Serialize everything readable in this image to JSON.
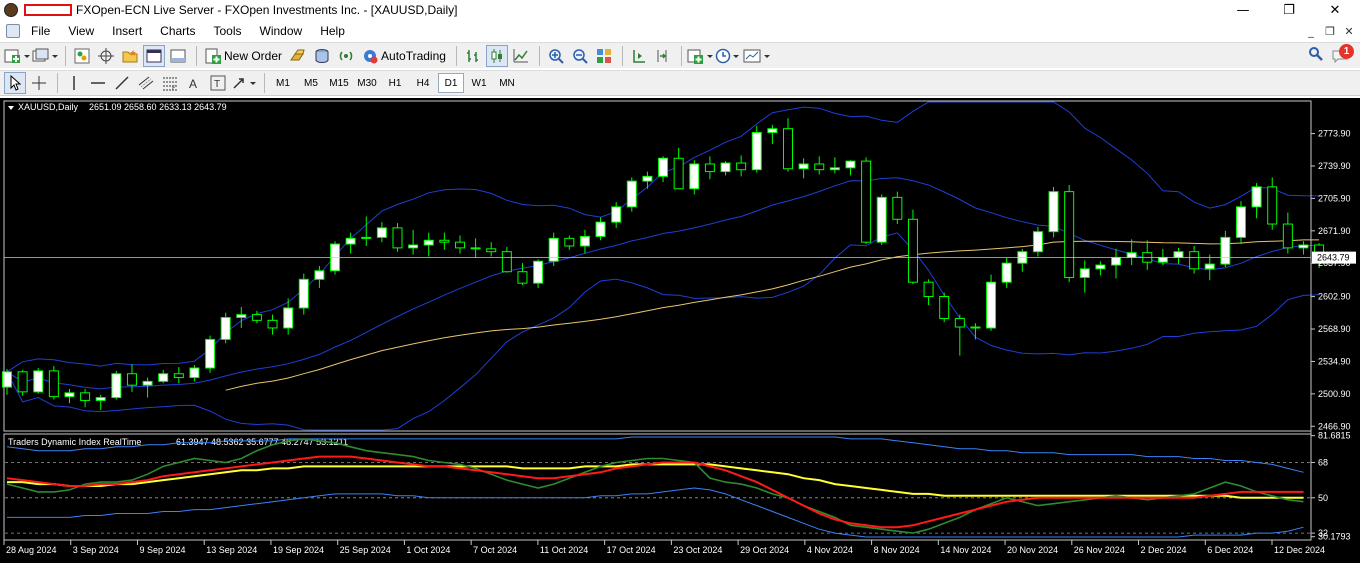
{
  "window": {
    "title": "FXOpen-ECN Live Server - FXOpen Investments Inc. - [XAUUSD,Daily]",
    "controls": [
      "—",
      "❐",
      "✕"
    ]
  },
  "menu": [
    "File",
    "View",
    "Insert",
    "Charts",
    "Tools",
    "Window",
    "Help"
  ],
  "mdi_controls": [
    "_",
    "❐",
    "✕"
  ],
  "toolbar": {
    "new_order_label": "New Order",
    "autotrading_label": "AutoTrading"
  },
  "timeframes": [
    "M1",
    "M5",
    "M15",
    "M30",
    "H1",
    "H4",
    "D1",
    "W1",
    "MN"
  ],
  "active_timeframe": "D1",
  "alerts": {
    "count": "1"
  },
  "chart_data": [
    {
      "type": "candlestick",
      "title": "XAUUSD,Daily",
      "ohlc_header": "2651.09 2658.60 2633.13 2643.79",
      "current_price": "2643.79",
      "y_ticks": [
        "2773.90",
        "2739.90",
        "2705.90",
        "2671.90",
        "2637.90",
        "2602.90",
        "2568.90",
        "2534.90",
        "2500.90",
        "2466.90"
      ],
      "y_range": [
        2463,
        2807
      ],
      "x_ticks": [
        "28 Aug 2024",
        "3 Sep 2024",
        "9 Sep 2024",
        "13 Sep 2024",
        "19 Sep 2024",
        "25 Sep 2024",
        "1 Oct 2024",
        "7 Oct 2024",
        "11 Oct 2024",
        "17 Oct 2024",
        "23 Oct 2024",
        "29 Oct 2024",
        "4 Nov 2024",
        "8 Nov 2024",
        "14 Nov 2024",
        "20 Nov 2024",
        "26 Nov 2024",
        "2 Dec 2024",
        "6 Dec 2024",
        "12 Dec 2024"
      ],
      "background": "#000000",
      "bull_color": "#ffffff",
      "bear_color": "#000000",
      "wick_color": "#00ff00",
      "candles_ohlc": [
        [
          2508,
          2527,
          2500,
          2524
        ],
        [
          2524,
          2526,
          2499,
          2503
        ],
        [
          2503,
          2528,
          2501,
          2525
        ],
        [
          2525,
          2530,
          2495,
          2498
        ],
        [
          2498,
          2506,
          2491,
          2502
        ],
        [
          2502,
          2506,
          2487,
          2494
        ],
        [
          2494,
          2500,
          2484,
          2497
        ],
        [
          2497,
          2525,
          2495,
          2522
        ],
        [
          2522,
          2532,
          2503,
          2510
        ],
        [
          2510,
          2518,
          2497,
          2514
        ],
        [
          2514,
          2526,
          2512,
          2522
        ],
        [
          2522,
          2529,
          2512,
          2518
        ],
        [
          2518,
          2531,
          2514,
          2528
        ],
        [
          2528,
          2562,
          2523,
          2558
        ],
        [
          2558,
          2586,
          2554,
          2581
        ],
        [
          2581,
          2592,
          2570,
          2584
        ],
        [
          2584,
          2588,
          2575,
          2578
        ],
        [
          2578,
          2584,
          2563,
          2570
        ],
        [
          2570,
          2601,
          2563,
          2591
        ],
        [
          2591,
          2627,
          2584,
          2621
        ],
        [
          2621,
          2635,
          2612,
          2630
        ],
        [
          2630,
          2661,
          2626,
          2658
        ],
        [
          2658,
          2670,
          2648,
          2664
        ],
        [
          2664,
          2687,
          2656,
          2665
        ],
        [
          2665,
          2681,
          2660,
          2675
        ],
        [
          2675,
          2680,
          2650,
          2654
        ],
        [
          2654,
          2673,
          2647,
          2657
        ],
        [
          2657,
          2670,
          2645,
          2662
        ],
        [
          2662,
          2670,
          2652,
          2660
        ],
        [
          2660,
          2667,
          2648,
          2654
        ],
        [
          2654,
          2664,
          2644,
          2653
        ],
        [
          2653,
          2660,
          2645,
          2650
        ],
        [
          2650,
          2655,
          2628,
          2629
        ],
        [
          2629,
          2638,
          2615,
          2617
        ],
        [
          2617,
          2642,
          2612,
          2640
        ],
        [
          2640,
          2670,
          2635,
          2664
        ],
        [
          2664,
          2667,
          2652,
          2656
        ],
        [
          2656,
          2673,
          2648,
          2666
        ],
        [
          2666,
          2686,
          2662,
          2681
        ],
        [
          2681,
          2702,
          2675,
          2697
        ],
        [
          2697,
          2728,
          2692,
          2724
        ],
        [
          2724,
          2734,
          2716,
          2729
        ],
        [
          2729,
          2750,
          2723,
          2748
        ],
        [
          2748,
          2759,
          2716,
          2716
        ],
        [
          2716,
          2746,
          2710,
          2742
        ],
        [
          2742,
          2750,
          2726,
          2734
        ],
        [
          2734,
          2745,
          2730,
          2743
        ],
        [
          2743,
          2751,
          2729,
          2736
        ],
        [
          2736,
          2782,
          2733,
          2775
        ],
        [
          2775,
          2783,
          2763,
          2779
        ],
        [
          2779,
          2790,
          2734,
          2737
        ],
        [
          2737,
          2748,
          2727,
          2742
        ],
        [
          2742,
          2750,
          2731,
          2736
        ],
        [
          2736,
          2749,
          2732,
          2738
        ],
        [
          2738,
          2746,
          2730,
          2745
        ],
        [
          2745,
          2749,
          2658,
          2660
        ],
        [
          2660,
          2710,
          2657,
          2707
        ],
        [
          2707,
          2713,
          2679,
          2684
        ],
        [
          2684,
          2694,
          2616,
          2618
        ],
        [
          2618,
          2621,
          2594,
          2603
        ],
        [
          2603,
          2607,
          2576,
          2580
        ],
        [
          2580,
          2584,
          2541,
          2571
        ],
        [
          2571,
          2575,
          2558,
          2570
        ],
        [
          2570,
          2626,
          2567,
          2618
        ],
        [
          2618,
          2644,
          2612,
          2638
        ],
        [
          2638,
          2653,
          2629,
          2650
        ],
        [
          2650,
          2676,
          2645,
          2671
        ],
        [
          2671,
          2718,
          2665,
          2713
        ],
        [
          2713,
          2720,
          2618,
          2623
        ],
        [
          2623,
          2641,
          2607,
          2632
        ],
        [
          2632,
          2640,
          2625,
          2636
        ],
        [
          2636,
          2653,
          2622,
          2644
        ],
        [
          2644,
          2663,
          2636,
          2649
        ],
        [
          2649,
          2662,
          2631,
          2639
        ],
        [
          2639,
          2653,
          2636,
          2644
        ],
        [
          2644,
          2654,
          2637,
          2650
        ],
        [
          2650,
          2656,
          2627,
          2632
        ],
        [
          2632,
          2647,
          2620,
          2637
        ],
        [
          2637,
          2672,
          2634,
          2665
        ],
        [
          2665,
          2703,
          2658,
          2697
        ],
        [
          2697,
          2722,
          2685,
          2718
        ],
        [
          2718,
          2728,
          2673,
          2679
        ],
        [
          2679,
          2691,
          2648,
          2654
        ],
        [
          2654,
          2661,
          2647,
          2657
        ],
        [
          2657,
          2659,
          2633,
          2644
        ]
      ]
    },
    {
      "type": "line",
      "title": "Traders Dynamic Index RealTime",
      "values_header": "61.3947 48.5362 35.6777 48.2747 53.1211",
      "y_ticks": [
        "81.6815",
        "68",
        "50",
        "32",
        "30.1793"
      ],
      "y_range": [
        29,
        82
      ],
      "levels": [
        68,
        50,
        32
      ],
      "series": [
        {
          "color": "#2e8b2e",
          "values": [
            57,
            55,
            53,
            53,
            54,
            57,
            58,
            58,
            59,
            62,
            66,
            68,
            70,
            69,
            68,
            70,
            74,
            77,
            79,
            80,
            79,
            78,
            76,
            74,
            73,
            72,
            71,
            69,
            68,
            67,
            65,
            62,
            59,
            57,
            55,
            57,
            60,
            63,
            66,
            68,
            69,
            70,
            70,
            69,
            68,
            60,
            58,
            57,
            55,
            52,
            50,
            46,
            43,
            40,
            36,
            35,
            34,
            33,
            32,
            34,
            37,
            40,
            44,
            47,
            50,
            48,
            46,
            47,
            48,
            49,
            50,
            51,
            50,
            49,
            50,
            51,
            52,
            55,
            58,
            56,
            53,
            51,
            49,
            48
          ]
        },
        {
          "color": "#ff1a1a",
          "values": [
            60,
            59,
            58,
            57,
            56,
            56,
            57,
            57,
            58,
            59,
            61,
            62,
            63,
            64,
            65,
            66,
            67,
            68,
            69,
            70,
            71,
            71,
            71,
            70,
            69,
            68,
            67,
            66,
            66,
            65,
            64,
            63,
            62,
            61,
            60,
            60,
            61,
            62,
            63,
            65,
            66,
            67,
            68,
            68,
            68,
            66,
            64,
            61,
            58,
            54,
            50,
            46,
            42,
            39,
            37,
            36,
            35,
            35,
            36,
            38,
            40,
            42,
            44,
            46,
            48,
            49,
            50,
            50,
            50,
            50,
            50,
            50,
            50,
            50,
            50,
            50,
            50,
            51,
            52,
            53,
            53,
            53,
            53,
            53
          ]
        },
        {
          "color": "#ffff33",
          "values": [
            58,
            58,
            57,
            57,
            56,
            56,
            56,
            57,
            57,
            58,
            59,
            60,
            61,
            62,
            63,
            64,
            64,
            65,
            65,
            66,
            66,
            66,
            66,
            66,
            66,
            66,
            66,
            66,
            66,
            66,
            66,
            66,
            66,
            65,
            65,
            65,
            65,
            66,
            66,
            66,
            67,
            67,
            67,
            67,
            67,
            67,
            66,
            65,
            64,
            63,
            62,
            60,
            59,
            57,
            56,
            55,
            54,
            53,
            52,
            52,
            51,
            51,
            51,
            51,
            51,
            51,
            51,
            51,
            51,
            51,
            51,
            51,
            51,
            51,
            51,
            51,
            51,
            51,
            51,
            50,
            50,
            50,
            50,
            50
          ]
        },
        {
          "color": "#3b82f6",
          "values": [
            76,
            75,
            74,
            74,
            74,
            75,
            75,
            76,
            76,
            77,
            77,
            78,
            78,
            78,
            79,
            79,
            79,
            79,
            80,
            80,
            80,
            80,
            80,
            80,
            80,
            80,
            80,
            80,
            80,
            80,
            80,
            80,
            80,
            80,
            80,
            80,
            80,
            80,
            80,
            80,
            81,
            81,
            81,
            81,
            81,
            81,
            81,
            81,
            81,
            81,
            81,
            81,
            81,
            81,
            80,
            80,
            80,
            79,
            78,
            77,
            76,
            75,
            75,
            74,
            74,
            73,
            73,
            73,
            72,
            72,
            72,
            72,
            72,
            71,
            71,
            71,
            70,
            70,
            69,
            69,
            68,
            67,
            65,
            63
          ]
        },
        {
          "color": "#3b82f6",
          "values": [
            40,
            40,
            40,
            40,
            40,
            41,
            41,
            42,
            42,
            42,
            43,
            43,
            44,
            44,
            45,
            46,
            47,
            48,
            49,
            50,
            51,
            52,
            52,
            52,
            52,
            51,
            51,
            50,
            50,
            50,
            50,
            50,
            50,
            50,
            50,
            50,
            50,
            50,
            51,
            51,
            52,
            52,
            53,
            54,
            55,
            54,
            52,
            49,
            46,
            43,
            40,
            37,
            34,
            32,
            31,
            30,
            30,
            30,
            30,
            30,
            30,
            30,
            30,
            30,
            30,
            30,
            30,
            30,
            30,
            30,
            30,
            30,
            30,
            30,
            30,
            30,
            31,
            31,
            31,
            31,
            32,
            32,
            33,
            35
          ]
        }
      ]
    }
  ]
}
